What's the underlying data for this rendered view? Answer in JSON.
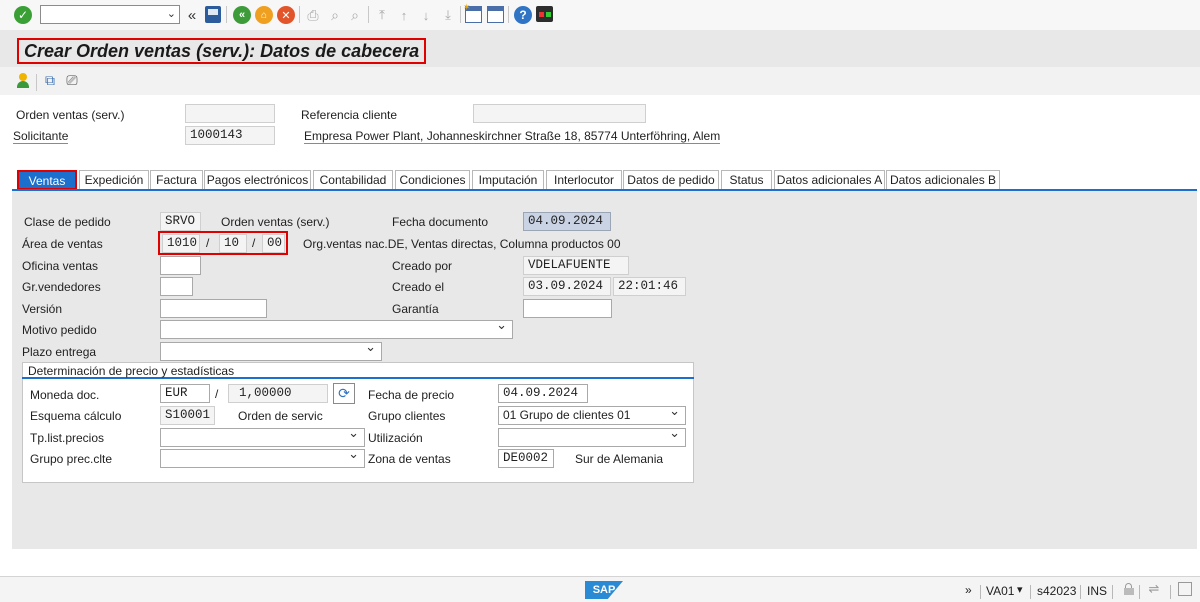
{
  "toolbar": {
    "icons": [
      "check-icon",
      "back-double-icon",
      "save-icon",
      "back-icon",
      "exit-icon",
      "cancel-icon",
      "print-icon",
      "find-icon",
      "find-next-icon",
      "first-page-icon",
      "prev-page-icon",
      "next-page-icon",
      "last-page-icon",
      "new-session-icon",
      "shortcut-icon",
      "help-icon",
      "layout-icon"
    ],
    "command_value": ""
  },
  "title": "Crear Orden ventas (serv.): Datos de cabecera",
  "header": {
    "orden_label": "Orden ventas (serv.)",
    "orden_value": "",
    "referencia_label": "Referencia cliente",
    "referencia_value": "",
    "solicitante_label": "Solicitante",
    "solicitante_value": "1000143",
    "solicitante_desc": "Empresa Power Plant, Johanneskirchner Straße 18, 85774 Unterföhring, Alem"
  },
  "tabs": [
    "Ventas",
    "Expedición",
    "Factura",
    "Pagos electrónicos",
    "Contabilidad",
    "Condiciones",
    "Imputación",
    "Interlocutor",
    "Datos de pedido",
    "Status",
    "Datos adicionales A",
    "Datos adicionales B"
  ],
  "ventas": {
    "clase_label": "Clase de pedido",
    "clase_value": "SRVO",
    "clase_desc": "Orden ventas (serv.)",
    "fecha_doc_label": "Fecha documento",
    "fecha_doc_value": "04.09.2024",
    "area_label": "Área de ventas",
    "area_org": "1010",
    "area_slash1": "/",
    "area_canal": "10",
    "area_slash2": "/",
    "area_sector": "00",
    "area_desc": "Org.ventas nac.DE, Ventas directas, Columna productos 00",
    "oficina_label": "Oficina ventas",
    "oficina_value": "",
    "creado_por_label": "Creado por",
    "creado_por_value": "VDELAFUENTE",
    "grvend_label": "Gr.vendedores",
    "grvend_value": "",
    "creado_el_label": "Creado el",
    "creado_el_date": "03.09.2024",
    "creado_el_time": "22:01:46",
    "version_label": "Versión",
    "version_value": "",
    "garantia_label": "Garantía",
    "garantia_value": "",
    "motivo_label": "Motivo pedido",
    "motivo_value": "",
    "plazo_label": "Plazo entrega",
    "plazo_value": ""
  },
  "precio": {
    "title": "Determinación de precio y estadísticas",
    "moneda_label": "Moneda doc.",
    "moneda_value": "EUR",
    "moneda_slash": "/",
    "tasa_value": "1,00000",
    "fecha_precio_label": "Fecha de precio",
    "fecha_precio_value": "04.09.2024",
    "esquema_label": "Esquema cálculo",
    "esquema_value": "S10001",
    "esquema_desc": "Orden de servic",
    "grupo_cli_label": "Grupo clientes",
    "grupo_cli_value": "01 Grupo de clientes 01",
    "tplist_label": "Tp.list.precios",
    "tplist_value": "",
    "utilizacion_label": "Utilización",
    "utilizacion_value": "",
    "grupoprec_label": "Grupo prec.clte",
    "grupoprec_value": "",
    "zona_label": "Zona de ventas",
    "zona_value": "DE0002",
    "zona_desc": "Sur de Alemania"
  },
  "status": {
    "chevron": "»",
    "transaction": "VA01",
    "dropdown": "▾",
    "server": "s42023",
    "mode": "INS",
    "logo": "SAP"
  },
  "colors": {
    "accent": "#1c6fcc",
    "highlight_red": "#e00000",
    "panel": "#e8e8e8"
  }
}
